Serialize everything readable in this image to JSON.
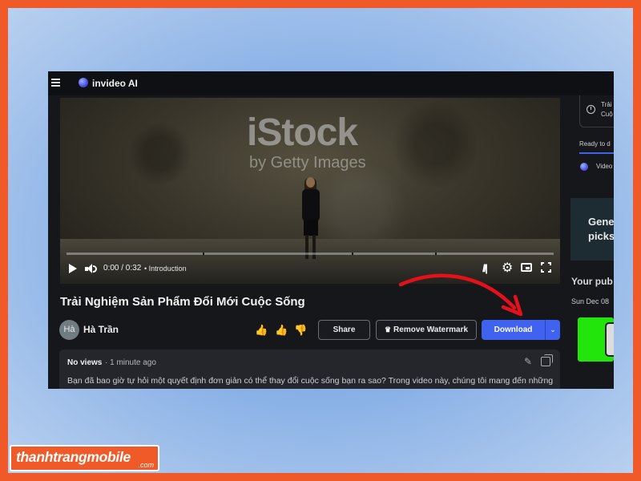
{
  "app": {
    "name": "invideo AI"
  },
  "video": {
    "watermark_main": "iStock",
    "watermark_sub": "by Getty Images",
    "time": "0:00 / 0:32",
    "chapter": "• Introduction",
    "progress": 0.0
  },
  "title": "Trải Nghiệm Sản Phẩm Đổi Mới Cuộc Sống",
  "author": {
    "initials": "Hà",
    "name": "Hà Trần"
  },
  "actions": {
    "share": "Share",
    "remove_watermark": "Remove Watermark",
    "download": "Download"
  },
  "description": {
    "views": "No views",
    "age": "· 1 minute ago",
    "text": "Bạn đã bao giờ tự hỏi một quyết định đơn giản có thể thay đổi cuộc sống bạn ra sao? Trong video này, chúng tôi mang đến những"
  },
  "sidebar": {
    "card_line1": "Trải",
    "card_line2": "Cuộ",
    "ready": "Ready to d",
    "video_label": "Video",
    "gen_line1": "Gene",
    "gen_line2": "picks",
    "publish": "Your pub",
    "publish_date": "Sun Dec 08"
  },
  "branding": {
    "name": "thanhtrangmobile",
    "suffix": ".com"
  },
  "colors": {
    "accent": "#3f63f0",
    "frame": "#f05a28",
    "green": "#22e60b"
  }
}
